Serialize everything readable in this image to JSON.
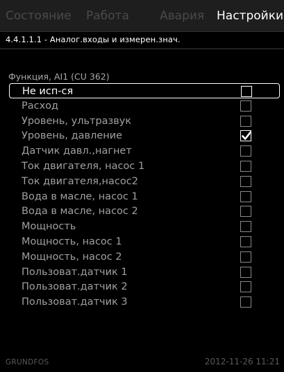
{
  "tabs": [
    {
      "label": "Состояние",
      "active": false
    },
    {
      "label": "Работа",
      "active": false
    },
    {
      "label": "Авария",
      "active": false
    },
    {
      "label": "Настройки",
      "active": true
    }
  ],
  "breadcrumb": "4.4.1.1.1 - Аналог.входы и измерен.знач.",
  "section_heading": "Функция, AI1 (CU 362)",
  "options": [
    {
      "label": "Не исп-ся",
      "checked": false,
      "selected": true
    },
    {
      "label": "Расход",
      "checked": false,
      "selected": false
    },
    {
      "label": "Уровень, ультразвук",
      "checked": false,
      "selected": false
    },
    {
      "label": "Уровень, давление",
      "checked": true,
      "selected": false
    },
    {
      "label": "Датчик давл.,нагнет",
      "checked": false,
      "selected": false
    },
    {
      "label": "Ток двигателя, насос 1",
      "checked": false,
      "selected": false
    },
    {
      "label": "Ток двигателя,насос2",
      "checked": false,
      "selected": false
    },
    {
      "label": "Вода в масле, насос 1",
      "checked": false,
      "selected": false
    },
    {
      "label": "Вода в масле, насос 2",
      "checked": false,
      "selected": false
    },
    {
      "label": "Мощность",
      "checked": false,
      "selected": false
    },
    {
      "label": "Мощность, насос 1",
      "checked": false,
      "selected": false
    },
    {
      "label": "Мощность, насос 2",
      "checked": false,
      "selected": false
    },
    {
      "label": "Пользоват.датчик 1",
      "checked": false,
      "selected": false
    },
    {
      "label": "Пользоват.датчик 2",
      "checked": false,
      "selected": false
    },
    {
      "label": "Пользоват.датчик 3",
      "checked": false,
      "selected": false
    }
  ],
  "footer": {
    "brand": "GRUNDFOS",
    "datetime": "2012-11-26 11:21"
  },
  "colors": {
    "background": "#000000",
    "tab_bar": "#1e1e1e",
    "active_text": "#ffffff",
    "inactive_tab_text": "#4a4a4a",
    "option_text": "#a0a0a0",
    "footer_text": "#5a5a5a"
  },
  "icons": {
    "checked": "check-mark-icon",
    "unchecked": "empty-checkbox-icon"
  }
}
